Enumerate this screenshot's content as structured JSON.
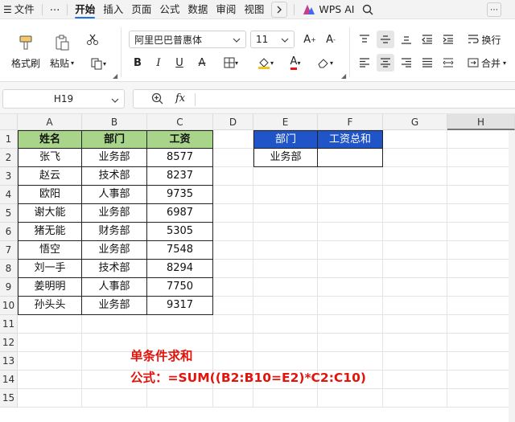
{
  "menu": {
    "file": "文件",
    "more": "⋯",
    "tabs": [
      "开始",
      "插入",
      "页面",
      "公式",
      "数据",
      "审阅",
      "视图"
    ],
    "active_tab": 0,
    "wps_ai": "WPS AI"
  },
  "ribbon": {
    "format_painter": "格式刷",
    "paste": "粘贴",
    "font_name": "阿里巴巴普惠体",
    "font_size": "11",
    "wrap": "换行",
    "merge": "合并"
  },
  "formula_bar": {
    "name_box": "H19",
    "fx_label": "fx",
    "formula": ""
  },
  "sheet": {
    "columns": [
      "A",
      "B",
      "C",
      "D",
      "E",
      "F",
      "G",
      "H"
    ],
    "selected_column": "H",
    "rows": [
      "1",
      "2",
      "3",
      "4",
      "5",
      "6",
      "7",
      "8",
      "9",
      "10",
      "11",
      "12",
      "13",
      "14",
      "15"
    ],
    "table_header": [
      "姓名",
      "部门",
      "工资"
    ],
    "table_rows": [
      [
        "张飞",
        "业务部",
        "8577"
      ],
      [
        "赵云",
        "技术部",
        "8237"
      ],
      [
        "欧阳",
        "人事部",
        "9735"
      ],
      [
        "谢大能",
        "业务部",
        "6987"
      ],
      [
        "猪无能",
        "财务部",
        "5305"
      ],
      [
        "悟空",
        "业务部",
        "7548"
      ],
      [
        "刘一手",
        "技术部",
        "8294"
      ],
      [
        "姜明明",
        "人事部",
        "7750"
      ],
      [
        "孙头头",
        "业务部",
        "9317"
      ]
    ],
    "summary_header": [
      "部门",
      "工资总和"
    ],
    "summary_row": [
      "业务部",
      ""
    ]
  },
  "annotation": {
    "title": "单条件求和",
    "formula": "公式：=SUM((B2:B10=E2)*C2:C10)"
  },
  "colors": {
    "green_header": "#a8d58a",
    "blue_header": "#1f55c8",
    "annotation_red": "#e3140c",
    "accent": "#1f6fe5"
  }
}
